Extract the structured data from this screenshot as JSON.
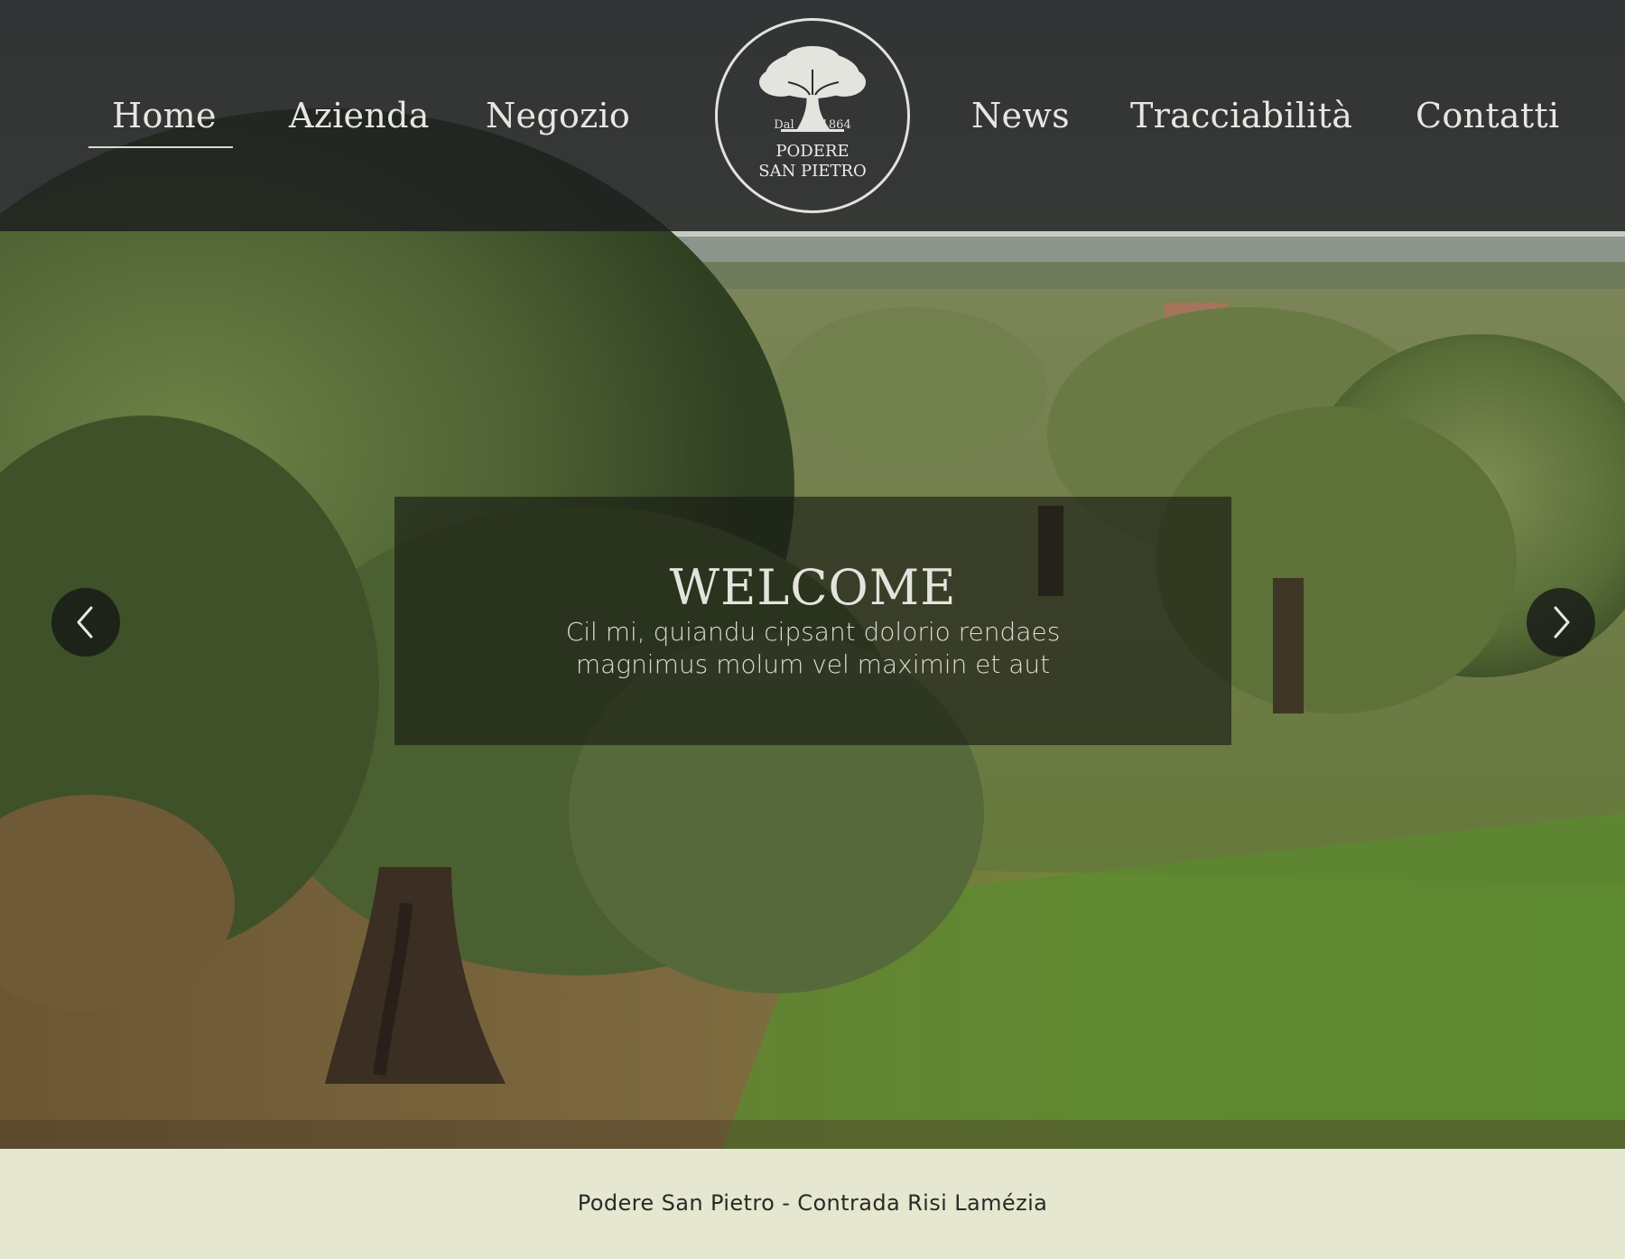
{
  "colors": {
    "header_bg": "#1e1f20",
    "nav_text": "#e7e7e2",
    "footer_bg": "#e6e7d0",
    "footer_text": "#2a2a26",
    "overlay_bg": "#161814"
  },
  "nav": {
    "items": [
      {
        "label": "Home",
        "active": true
      },
      {
        "label": "Azienda"
      },
      {
        "label": "Negozio"
      },
      {
        "label": "News"
      },
      {
        "label": "Tracciabilità"
      },
      {
        "label": "Contatti"
      }
    ]
  },
  "logo": {
    "since_label": "Dal",
    "since_year": "1864",
    "name_line1": "PODERE",
    "name_line2": "SAN PIETRO",
    "icon": "olive-tree-icon"
  },
  "hero": {
    "title": "WELCOME",
    "text": "Cil mi, quiandu cipsant dolorio rendaes magnimus molum vel maximin et aut",
    "prev_icon": "chevron-left-icon",
    "next_icon": "chevron-right-icon"
  },
  "footer": {
    "text": "Podere San Pietro - Contrada Risi Lamézia"
  }
}
